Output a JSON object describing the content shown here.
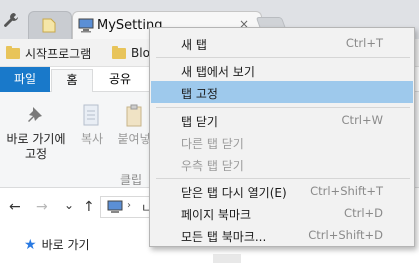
{
  "browser": {
    "active_tab_title": "MySetting",
    "active_tab_close": "×"
  },
  "bookmarks": {
    "items": [
      "시작프로그램",
      "Blog"
    ]
  },
  "ribbon": {
    "tabs": {
      "file": "파일",
      "home": "홈",
      "share": "공유"
    },
    "pin_label": "바로 가기에\n고정",
    "copy_label": "복사",
    "paste_label": "붙여넣",
    "group_label": "클립"
  },
  "addressbar": {
    "back": "←",
    "forward": "→",
    "recent": "⌄",
    "up": "↑",
    "caret": "›",
    "path_text": "ㄴ"
  },
  "navpane": {
    "quick_access": "바로 가기"
  },
  "context_menu": {
    "items": [
      {
        "label": "새 탭",
        "shortcut": "Ctrl+T",
        "state": "normal"
      },
      {
        "label": "새 탭에서 보기",
        "shortcut": "",
        "state": "normal"
      },
      {
        "label": "탭 고정",
        "shortcut": "",
        "state": "highlighted"
      },
      {
        "label": "탭 닫기",
        "shortcut": "Ctrl+W",
        "state": "normal"
      },
      {
        "label": "다른 탭 닫기",
        "shortcut": "",
        "state": "disabled"
      },
      {
        "label": "우측 탭 닫기",
        "shortcut": "",
        "state": "disabled"
      },
      {
        "label": "닫은 탭 다시 열기(E)",
        "shortcut": "Ctrl+Shift+T",
        "state": "normal"
      },
      {
        "label": "페이지 북마크",
        "shortcut": "Ctrl+D",
        "state": "normal"
      },
      {
        "label": "모든 탭 북마크...",
        "shortcut": "Ctrl+Shift+D",
        "state": "normal"
      }
    ]
  },
  "colors": {
    "menu_highlight": "#9ec9ec",
    "file_tab": "#1979ca",
    "folder": "#e8c45a"
  }
}
